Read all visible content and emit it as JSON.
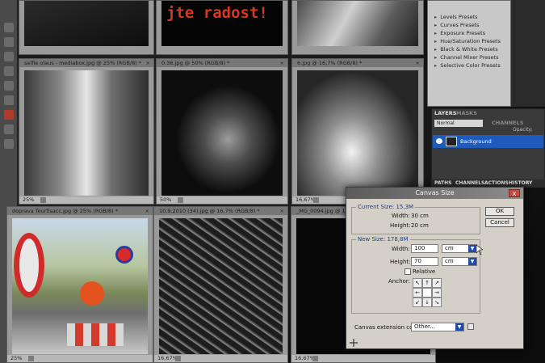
{
  "documents": [
    {
      "id": "doc1",
      "tab": "",
      "zoom": "",
      "photo": "dark"
    },
    {
      "id": "doc2",
      "tab": "",
      "zoom": "",
      "photo_text": "jte radost!"
    },
    {
      "id": "doc3",
      "tab": "",
      "zoom": "",
      "photo": "cat"
    },
    {
      "id": "doc4",
      "tab": "selfie olaus - mediabox.jpg @ 25% (RGB/8) *",
      "zoom": "25%",
      "photo": "man"
    },
    {
      "id": "doc5",
      "tab": "0.36.jpg @ 50% (RGB/8) *",
      "zoom": "50%",
      "photo": "lens"
    },
    {
      "id": "doc6",
      "tab": "6.jpg @ 16,7% (RGB/8) *",
      "zoom": "16,67%",
      "photo": "tunnel"
    },
    {
      "id": "doc7",
      "tab": "doprava Tourfisacc.jpg @ 25% (RGB/8) *",
      "zoom": "25%",
      "photo": "street"
    },
    {
      "id": "doc8",
      "tab": "10.9.2010 (34).jpg @ 16,7% (RGB/8) *",
      "zoom": "16,67%",
      "photo": "bikes"
    },
    {
      "id": "doc9",
      "tab": "_MG_0094.jpg @ 16,7%",
      "zoom": "16,67%",
      "photo": "black"
    }
  ],
  "adjustments_panel": {
    "items": [
      "Levels Presets",
      "Curves Presets",
      "Exposure Presets",
      "Hue/Saturation Presets",
      "Black & White Presets",
      "Channel Mixer Presets",
      "Selective Color Presets"
    ]
  },
  "layers_panel": {
    "tabs": [
      "LAYERS",
      "MASKS"
    ],
    "blend_mode": "Normal",
    "opacity_label": "Opacity:",
    "right_tabs": [
      "CHANNELS",
      "ACTIONS",
      "HISTORY"
    ],
    "layer_name": "Background"
  },
  "bottom_tabs": [
    "PATHS",
    "CHANNELS",
    "ACTIONS",
    "HISTORY"
  ],
  "canvas_size_dialog": {
    "title": "Canvas Size",
    "current_size_label": "Current Size: 15,3M",
    "current_width_label": "Width:",
    "current_width_value": "30 cm",
    "current_height_label": "Height:",
    "current_height_value": "20 cm",
    "new_size_label": "New Size: 178,8M",
    "width_label": "Width:",
    "width_value": "100",
    "width_unit": "cm",
    "height_label": "Height:",
    "height_value": "70",
    "height_unit": "cm",
    "relative_label": "Relative",
    "anchor_label": "Anchor:",
    "anchor_arrows": [
      "↖",
      "↑",
      "↗",
      "←",
      "",
      "→",
      "↙",
      "↓",
      "↘"
    ],
    "extension_color_label": "Canvas extension color:",
    "extension_color_value": "Other...",
    "ok_label": "OK",
    "cancel_label": "Cancel",
    "close_label": "x"
  }
}
